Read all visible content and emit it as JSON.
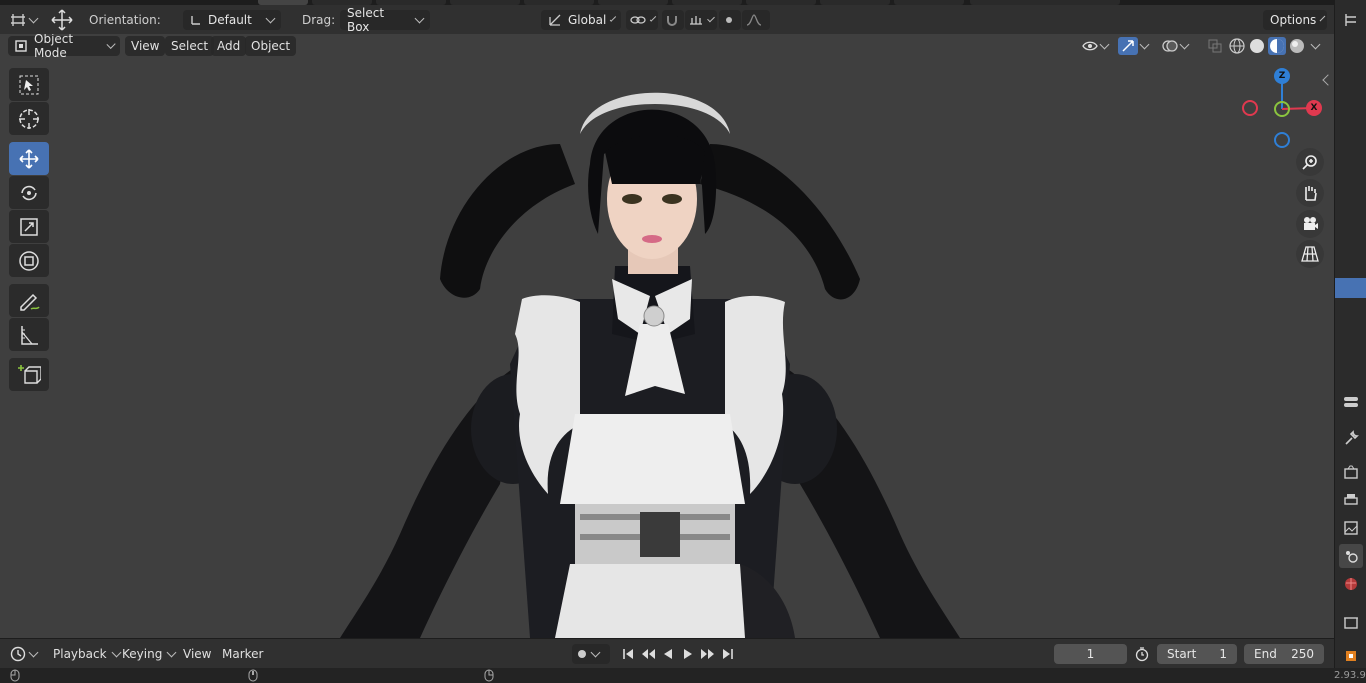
{
  "header": {
    "orientation_label": "Orientation:",
    "orientation_value": "Default",
    "drag_label": "Drag:",
    "drag_value": "Select Box",
    "transform_space": "Global",
    "options_label": "Options"
  },
  "viewport_header": {
    "mode": "Object Mode",
    "menus": [
      "View",
      "Select",
      "Add",
      "Object"
    ]
  },
  "toolbar": {
    "tools": [
      {
        "name": "select-box-tool",
        "icon": "select-box-icon",
        "active": false
      },
      {
        "name": "cursor-tool",
        "icon": "cursor-icon",
        "active": false
      },
      {
        "name": "move-tool",
        "icon": "move-icon",
        "active": true
      },
      {
        "name": "rotate-tool",
        "icon": "rotate-icon",
        "active": false
      },
      {
        "name": "scale-tool",
        "icon": "scale-icon",
        "active": false
      },
      {
        "name": "transform-tool",
        "icon": "transform-icon",
        "active": false
      },
      {
        "name": "annotate-tool",
        "icon": "annotate-icon",
        "active": false
      },
      {
        "name": "measure-tool",
        "icon": "measure-icon",
        "active": false
      },
      {
        "name": "add-cube-tool",
        "icon": "add-cube-icon",
        "active": false
      }
    ]
  },
  "gizmo": {
    "z_label": "Z",
    "x_label": "X"
  },
  "timeline": {
    "menus": [
      "Playback",
      "Keying",
      "View",
      "Marker"
    ],
    "current_frame": "1",
    "start_label": "Start",
    "start_value": "1",
    "end_label": "End",
    "end_value": "250"
  },
  "version": "2.93.9",
  "colors": {
    "accent": "#4772b3",
    "axis_x": "#e0394f",
    "axis_y": "#8bc43f",
    "axis_z": "#2f7fd6",
    "viewport_bg": "#3f3f3f"
  }
}
